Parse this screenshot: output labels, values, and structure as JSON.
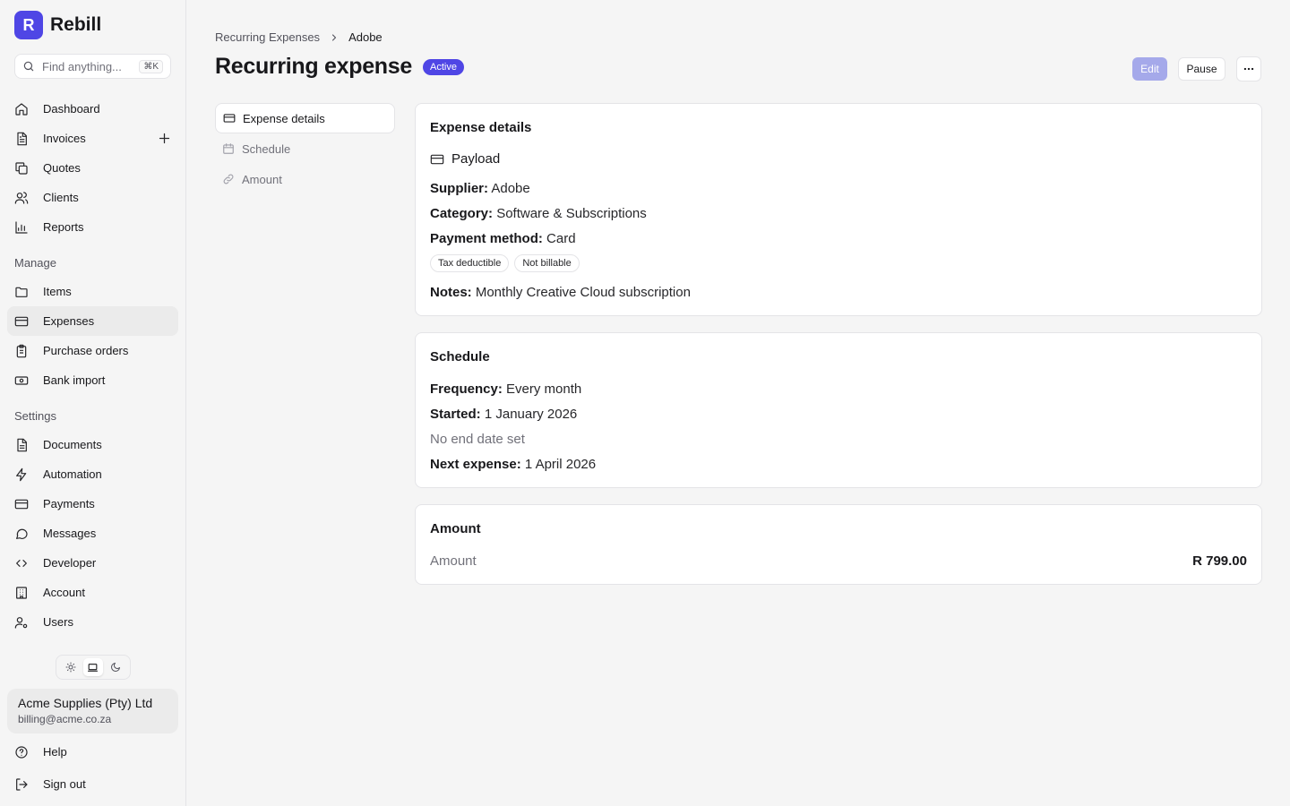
{
  "app": {
    "logo_letter": "R",
    "name": "Rebill"
  },
  "search": {
    "placeholder": "Find anything...",
    "shortcut": "⌘K"
  },
  "sidebar": {
    "main_items": [
      {
        "label": "Dashboard",
        "icon": "home-icon"
      },
      {
        "label": "Invoices",
        "icon": "document-icon"
      },
      {
        "label": "Quotes",
        "icon": "copy-icon"
      },
      {
        "label": "Clients",
        "icon": "users-icon"
      },
      {
        "label": "Reports",
        "icon": "chart-icon"
      }
    ],
    "manage_label": "Manage",
    "manage_items": [
      {
        "label": "Items",
        "icon": "folder-icon"
      },
      {
        "label": "Expenses",
        "icon": "credit-card-icon",
        "active": true
      },
      {
        "label": "Purchase orders",
        "icon": "clipboard-icon"
      },
      {
        "label": "Bank import",
        "icon": "banknote-icon"
      }
    ],
    "settings_label": "Settings",
    "settings_items": [
      {
        "label": "Documents",
        "icon": "document-icon"
      },
      {
        "label": "Automation",
        "icon": "bolt-icon"
      },
      {
        "label": "Payments",
        "icon": "credit-card-icon"
      },
      {
        "label": "Messages",
        "icon": "message-icon"
      },
      {
        "label": "Developer",
        "icon": "code-icon"
      },
      {
        "label": "Account",
        "icon": "building-icon"
      },
      {
        "label": "Users",
        "icon": "user-cog-icon"
      }
    ],
    "account": {
      "name": "Acme Supplies (Pty) Ltd",
      "email": "billing@acme.co.za"
    },
    "help_label": "Help",
    "signout_label": "Sign out"
  },
  "breadcrumb": {
    "parent": "Recurring Expenses",
    "current": "Adobe"
  },
  "header": {
    "title": "Recurring expense",
    "status": "Active",
    "edit_label": "Edit",
    "pause_label": "Pause"
  },
  "subnav": [
    {
      "label": "Expense details",
      "active": true
    },
    {
      "label": "Schedule"
    },
    {
      "label": "Amount"
    }
  ],
  "expense_details": {
    "title": "Expense details",
    "payload_label": "Payload",
    "supplier_label": "Supplier:",
    "supplier": "Adobe",
    "category_label": "Category:",
    "category": "Software & Subscriptions",
    "payment_method_label": "Payment method:",
    "payment_method": "Card",
    "tags": [
      "Tax deductible",
      "Not billable"
    ],
    "notes_label": "Notes:",
    "notes": "Monthly Creative Cloud subscription"
  },
  "schedule": {
    "title": "Schedule",
    "frequency_label": "Frequency:",
    "frequency": "Every month",
    "started_label": "Started:",
    "started": "1 January 2026",
    "end_text": "No end date set",
    "next_label": "Next expense:",
    "next": "1 April 2026"
  },
  "amount": {
    "title": "Amount",
    "label": "Amount",
    "value": "R 799.00"
  },
  "colors": {
    "accent": "#4f46e5",
    "edit_disabled": "#a5a9ea"
  }
}
